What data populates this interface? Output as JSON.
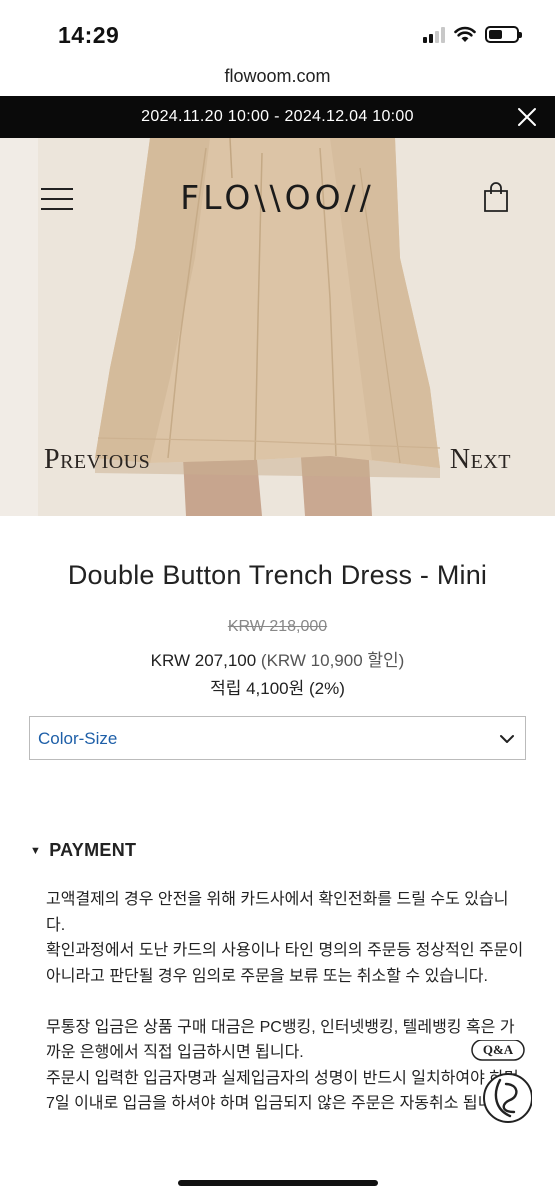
{
  "status_bar": {
    "time": "14:29"
  },
  "browser": {
    "url": "flowoom.com"
  },
  "promo": {
    "text": "2024.11.20 10:00 - 2024.12.04 10:00"
  },
  "brand": {
    "logo": "FLO\\\\OO//"
  },
  "hero_nav": {
    "previous": "Previous",
    "next": "Next"
  },
  "product": {
    "title": "Double Button Trench Dress - Mini",
    "original_price": "KRW 218,000",
    "sale_price": "KRW 207,100",
    "discount": "(KRW 10,900 할인)",
    "points": "적립 4,100원 (2%)"
  },
  "options": {
    "select_label": "Color-Size"
  },
  "payment": {
    "heading": "PAYMENT",
    "para1": "고액결제의 경우 안전을 위해 카드사에서 확인전화를 드릴 수도 있습니다.\n확인과정에서 도난 카드의 사용이나 타인 명의의 주문등 정상적인 주문이 아니라고 판단될 경우 임의로 주문을 보류 또는 취소할 수 있습니다.",
    "para2": "무통장 입금은 상품 구매 대금은 PC뱅킹, 인터넷뱅킹, 텔레뱅킹 혹은 가까운 은행에서 직접 입금하시면 됩니다.\n주문시 입력한 입금자명과 실제입금자의 성명이 반드시 일치하여야 하며, 7일 이내로 입금을 하셔야 하며 입금되지 않은 주문은 자동취소 됩니다."
  },
  "qa_badge": {
    "label": "Q&A"
  },
  "colors": {
    "banner_bg": "#0a0a0a",
    "select_text": "#1e5fa8",
    "hero_bg": "#e9e1d6"
  }
}
